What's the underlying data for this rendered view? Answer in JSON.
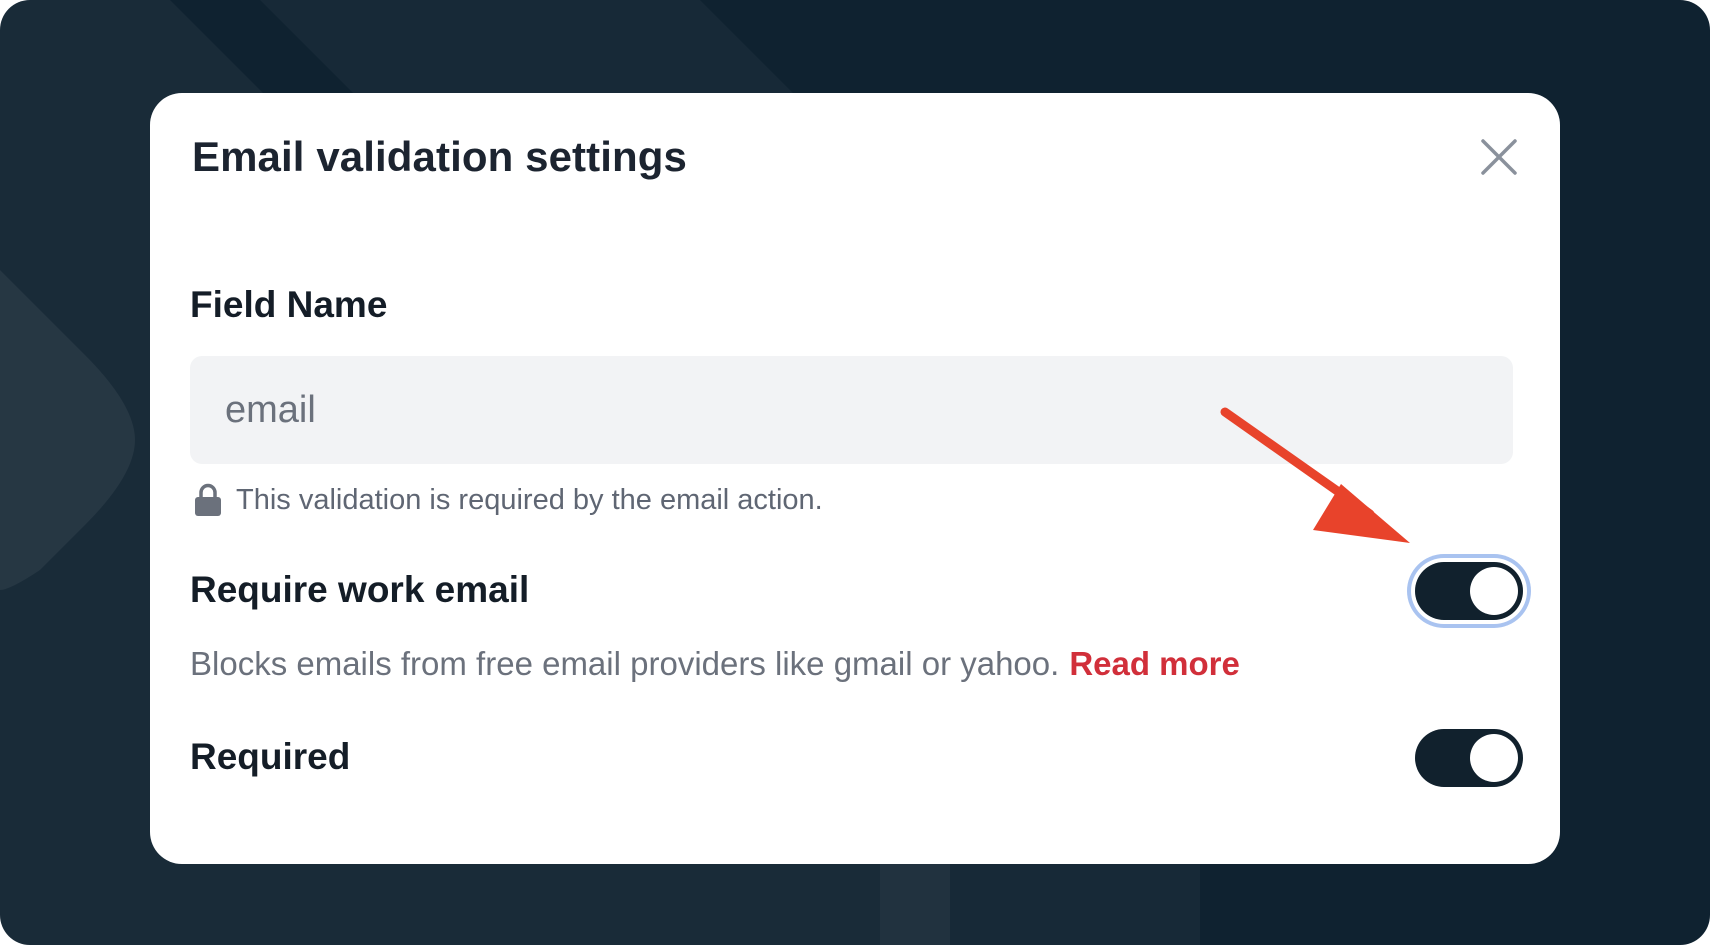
{
  "modal": {
    "title": "Email validation settings",
    "close_icon": "close-icon"
  },
  "field": {
    "label": "Field Name",
    "value": "email",
    "lock_icon": "lock-icon",
    "note": "This validation is required by the email action."
  },
  "settings": {
    "work_email": {
      "label": "Require work email",
      "description": "Blocks emails from free email providers like gmail or yahoo.",
      "read_more": "Read more",
      "enabled": true,
      "focused": true
    },
    "required": {
      "label": "Required",
      "enabled": true
    }
  },
  "colors": {
    "background": "#0f2230",
    "toggle_on": "#11212d",
    "link": "#d12f3a",
    "annotation_arrow": "#e8432b",
    "focus_ring": "#a9c3f0"
  }
}
